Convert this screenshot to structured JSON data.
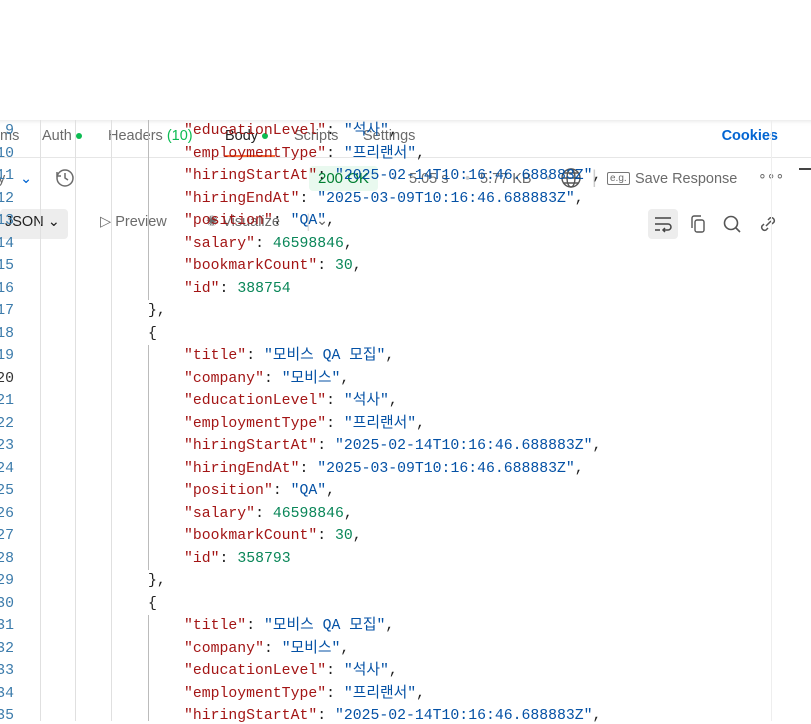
{
  "tabs": [
    {
      "label": "ms"
    },
    {
      "label": "Auth",
      "dot": true
    },
    {
      "label": "Headers",
      "count": "(10)"
    },
    {
      "label": "Body",
      "dot": true,
      "active": true
    },
    {
      "label": "Scripts"
    },
    {
      "label": "Settings"
    }
  ],
  "cookies": "Cookies",
  "response": {
    "history_label": "y",
    "status": "200 OK",
    "time": "5.05 s",
    "size": "5.77 KB",
    "save": "Save Response",
    "eg": "e.g."
  },
  "format": {
    "json": "JSON",
    "preview": "Preview",
    "visualize": "Visualize"
  },
  "colors": {
    "key": "#a31515",
    "string": "#0451a5",
    "number": "#098658",
    "accent": "#ff6c37",
    "status_ok": "#007f31"
  },
  "current_line": 20,
  "lines": [
    {
      "n": 9,
      "i": 2,
      "k": "educationLevel",
      "v": "석사",
      "t": "s",
      "c": ","
    },
    {
      "n": 10,
      "i": 2,
      "k": "employmentType",
      "v": "프리랜서",
      "t": "s",
      "c": ","
    },
    {
      "n": 11,
      "i": 2,
      "k": "hiringStartAt",
      "v": "2025-02-14T10:16:46.688883Z",
      "t": "s",
      "c": ","
    },
    {
      "n": 12,
      "i": 2,
      "k": "hiringEndAt",
      "v": "2025-03-09T10:16:46.688883Z",
      "t": "s",
      "c": ","
    },
    {
      "n": 13,
      "i": 2,
      "k": "position",
      "v": "QA",
      "t": "s",
      "c": ","
    },
    {
      "n": 14,
      "i": 2,
      "k": "salary",
      "v": "46598846",
      "t": "n",
      "c": ","
    },
    {
      "n": 15,
      "i": 2,
      "k": "bookmarkCount",
      "v": "30",
      "t": "n",
      "c": ","
    },
    {
      "n": 16,
      "i": 2,
      "k": "id",
      "v": "388754",
      "t": "n",
      "c": ""
    },
    {
      "n": 17,
      "i": 1,
      "raw": "},"
    },
    {
      "n": 18,
      "i": 1,
      "raw": "{"
    },
    {
      "n": 19,
      "i": 2,
      "k": "title",
      "v": "모비스 QA 모집",
      "t": "s",
      "c": ","
    },
    {
      "n": 20,
      "i": 2,
      "k": "company",
      "v": "모비스",
      "t": "s",
      "c": ","
    },
    {
      "n": 21,
      "i": 2,
      "k": "educationLevel",
      "v": "석사",
      "t": "s",
      "c": ","
    },
    {
      "n": 22,
      "i": 2,
      "k": "employmentType",
      "v": "프리랜서",
      "t": "s",
      "c": ","
    },
    {
      "n": 23,
      "i": 2,
      "k": "hiringStartAt",
      "v": "2025-02-14T10:16:46.688883Z",
      "t": "s",
      "c": ","
    },
    {
      "n": 24,
      "i": 2,
      "k": "hiringEndAt",
      "v": "2025-03-09T10:16:46.688883Z",
      "t": "s",
      "c": ","
    },
    {
      "n": 25,
      "i": 2,
      "k": "position",
      "v": "QA",
      "t": "s",
      "c": ","
    },
    {
      "n": 26,
      "i": 2,
      "k": "salary",
      "v": "46598846",
      "t": "n",
      "c": ","
    },
    {
      "n": 27,
      "i": 2,
      "k": "bookmarkCount",
      "v": "30",
      "t": "n",
      "c": ","
    },
    {
      "n": 28,
      "i": 2,
      "k": "id",
      "v": "358793",
      "t": "n",
      "c": ""
    },
    {
      "n": 29,
      "i": 1,
      "raw": "},"
    },
    {
      "n": 30,
      "i": 1,
      "raw": "{"
    },
    {
      "n": 31,
      "i": 2,
      "k": "title",
      "v": "모비스 QA 모집",
      "t": "s",
      "c": ","
    },
    {
      "n": 32,
      "i": 2,
      "k": "company",
      "v": "모비스",
      "t": "s",
      "c": ","
    },
    {
      "n": 33,
      "i": 2,
      "k": "educationLevel",
      "v": "석사",
      "t": "s",
      "c": ","
    },
    {
      "n": 34,
      "i": 2,
      "k": "employmentType",
      "v": "프리랜서",
      "t": "s",
      "c": ","
    },
    {
      "n": 35,
      "i": 2,
      "k": "hiringStartAt",
      "v": "2025-02-14T10:16:46.688883Z",
      "t": "s",
      "c": ","
    }
  ]
}
